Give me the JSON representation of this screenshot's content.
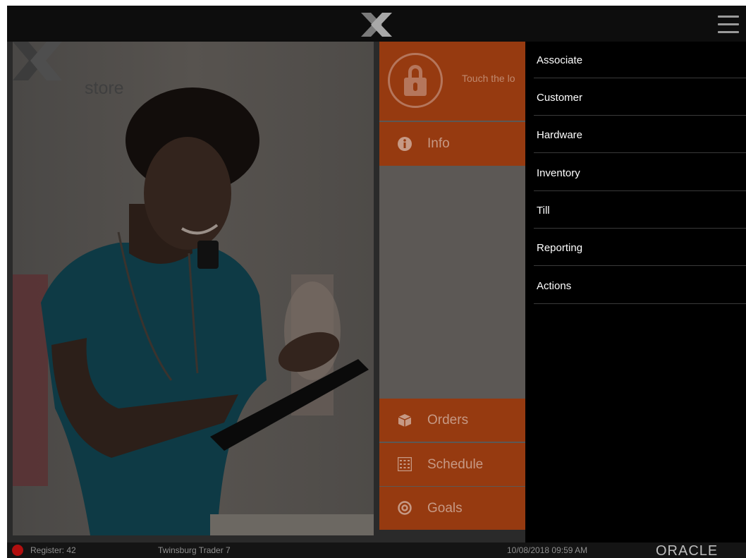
{
  "header": {
    "logo_icon": "x-logo-icon",
    "menu_icon": "hamburger-menu-icon"
  },
  "hero": {
    "brand_text": "store",
    "brand_icon": "xstore-logo-icon"
  },
  "lock_tile": {
    "icon": "padlock-icon",
    "text": "Touch the lo"
  },
  "tiles": {
    "info": {
      "label": "Info",
      "icon": "info-icon"
    },
    "orders": {
      "label": "Orders",
      "icon": "box-icon"
    },
    "schedule": {
      "label": "Schedule",
      "icon": "calendar-grid-icon"
    },
    "goals": {
      "label": "Goals",
      "icon": "target-icon"
    }
  },
  "menu": {
    "items": [
      {
        "label": "Associate"
      },
      {
        "label": "Customer"
      },
      {
        "label": "Hardware"
      },
      {
        "label": "Inventory"
      },
      {
        "label": "Till"
      },
      {
        "label": "Reporting"
      },
      {
        "label": "Actions"
      }
    ]
  },
  "status": {
    "register": "Register: 42",
    "store": "Twinsburg Trader 7",
    "datetime": "10/08/2018 09:59 AM",
    "vendor": "ORACLE",
    "indicator_color": "#b10f0f"
  },
  "colors": {
    "accent": "#963a10",
    "menu_bg": "#000000",
    "overlay": "dimmed"
  }
}
